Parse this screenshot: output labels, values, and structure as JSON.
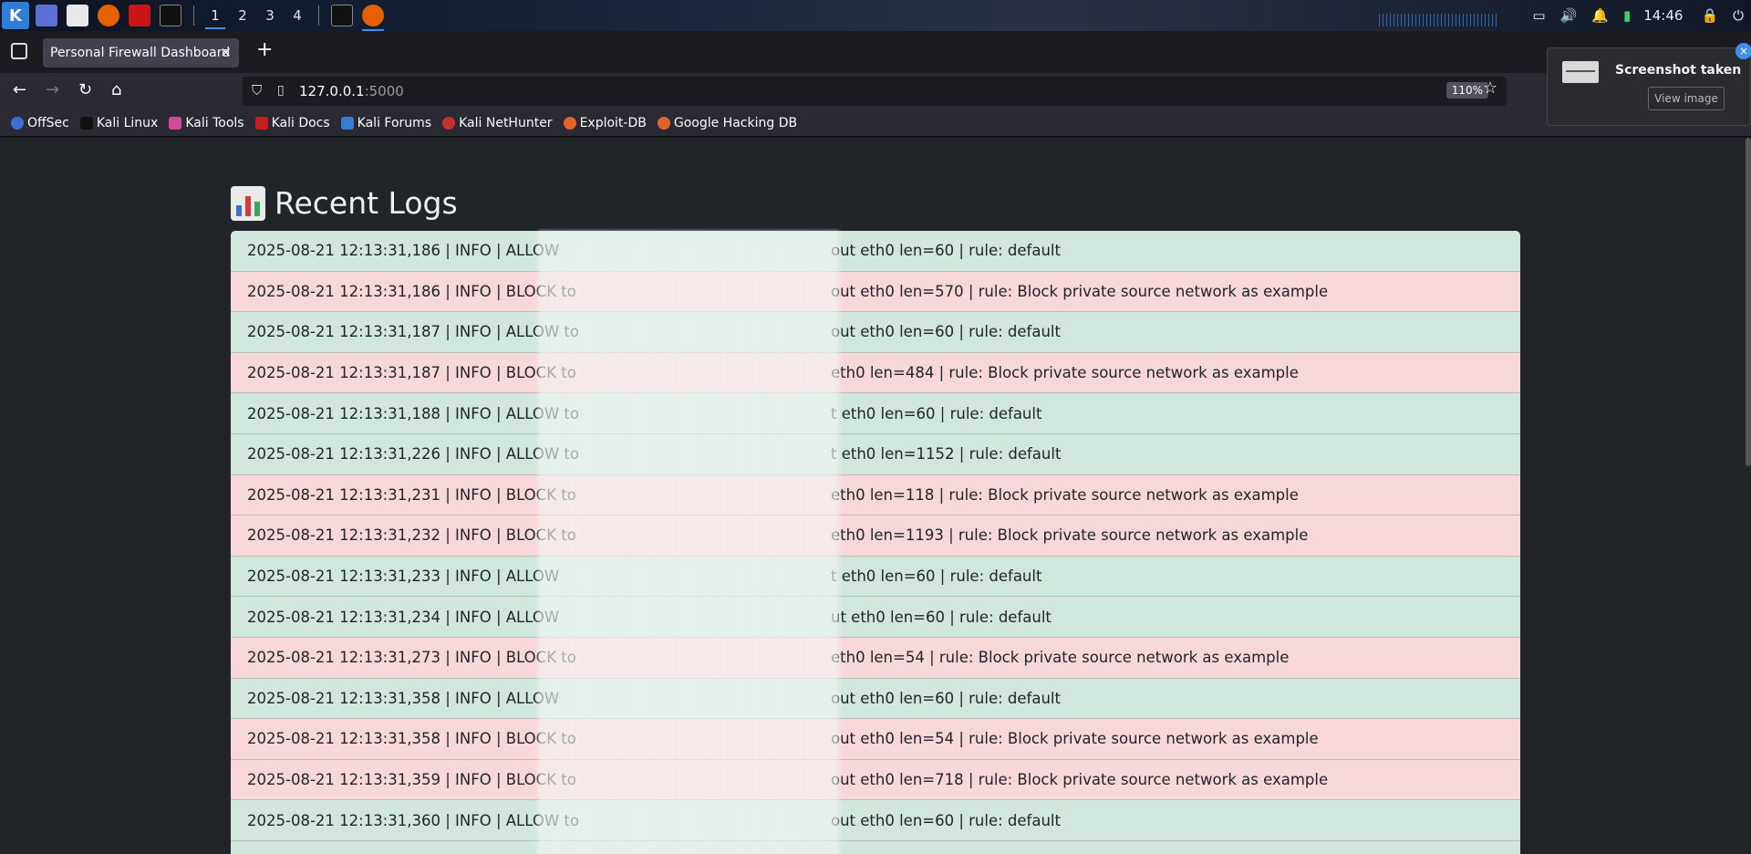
{
  "system_panel": {
    "workspaces": [
      "1",
      "2",
      "3",
      "4"
    ],
    "active_workspace": "1",
    "clock": "14:46"
  },
  "browser": {
    "tab_title": "Personal Firewall Dashboard",
    "url_host": "127.0.0.1",
    "url_port": ":5000",
    "zoom": "110%",
    "bookmarks": [
      "OffSec",
      "Kali Linux",
      "Kali Tools",
      "Kali Docs",
      "Kali Forums",
      "Kali NetHunter",
      "Exploit-DB",
      "Google Hacking DB"
    ]
  },
  "notification": {
    "title": "Screenshot taken",
    "button": "View image"
  },
  "page": {
    "title": "Recent Logs",
    "logs": [
      {
        "type": "allow",
        "prefix": "2025-08-21 12:13:31,186 | INFO | ALLOW",
        "suffix": "out eth0 len=60 | rule: default"
      },
      {
        "type": "block",
        "prefix": "2025-08-21 12:13:31,186 | INFO | BLOCK to",
        "suffix": "out eth0 len=570 | rule: Block private source network as example"
      },
      {
        "type": "allow",
        "prefix": "2025-08-21 12:13:31,187 | INFO | ALLOW to",
        "suffix": "out eth0 len=60 | rule: default"
      },
      {
        "type": "block",
        "prefix": "2025-08-21 12:13:31,187 | INFO | BLOCK to",
        "suffix": "eth0 len=484 | rule: Block private source network as example"
      },
      {
        "type": "allow",
        "prefix": "2025-08-21 12:13:31,188 | INFO | ALLOW to",
        "suffix": "t eth0 len=60 | rule: default"
      },
      {
        "type": "allow",
        "prefix": "2025-08-21 12:13:31,226 | INFO | ALLOW to",
        "suffix": "t eth0 len=1152 | rule: default"
      },
      {
        "type": "block",
        "prefix": "2025-08-21 12:13:31,231 | INFO | BLOCK to",
        "suffix": "eth0 len=118 | rule: Block private source network as example"
      },
      {
        "type": "block",
        "prefix": "2025-08-21 12:13:31,232 | INFO | BLOCK to",
        "suffix": "eth0 len=1193 | rule: Block private source network as example"
      },
      {
        "type": "allow",
        "prefix": "2025-08-21 12:13:31,233 | INFO | ALLOW",
        "suffix": "t eth0 len=60 | rule: default"
      },
      {
        "type": "allow",
        "prefix": "2025-08-21 12:13:31,234 | INFO | ALLOW",
        "suffix": "ut eth0 len=60 | rule: default"
      },
      {
        "type": "block",
        "prefix": "2025-08-21 12:13:31,273 | INFO | BLOCK to",
        "suffix": "eth0 len=54 | rule: Block private source network as example"
      },
      {
        "type": "allow",
        "prefix": "2025-08-21 12:13:31,358 | INFO | ALLOW",
        "suffix": "out eth0 len=60 | rule: default"
      },
      {
        "type": "block",
        "prefix": "2025-08-21 12:13:31,358 | INFO | BLOCK to",
        "suffix": "out eth0 len=54 | rule: Block private source network as example"
      },
      {
        "type": "block",
        "prefix": "2025-08-21 12:13:31,359 | INFO | BLOCK to",
        "suffix": "out eth0 len=718 | rule: Block private source network as example"
      },
      {
        "type": "allow",
        "prefix": "2025-08-21 12:13:31,360 | INFO | ALLOW to",
        "suffix": "out eth0 len=60 | rule: default"
      },
      {
        "type": "allow",
        "prefix": "",
        "suffix": ""
      }
    ]
  },
  "colors": {
    "allow_bg": "#d1e7dd",
    "block_bg": "#f8d7da",
    "page_bg": "#212529",
    "accent": "#3d8fe8"
  }
}
